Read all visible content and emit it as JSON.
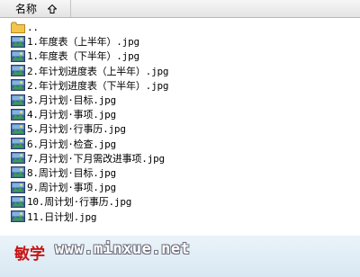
{
  "header": {
    "name_column": "名称",
    "sort_icon": "up-arrow-icon"
  },
  "parent_folder": "..",
  "files": [
    "1.年度表（上半年）.jpg",
    "1.年度表（下半年）.jpg",
    "2.年计划进度表（上半年）.jpg",
    "2.年计划进度表（下半年）.jpg",
    "3.月计划·目标.jpg",
    "4.月计划·事项.jpg",
    "5.月计划·行事历.jpg",
    "6.月计划·检查.jpg",
    "7.月计划·下月需改进事项.jpg",
    "8.周计划·目标.jpg",
    "9.周计划·事项.jpg",
    "10.周计划·行事历.jpg",
    "11.日计划.jpg"
  ],
  "watermark": {
    "logo": "敏学",
    "url": "www.minxue.net"
  },
  "colors": {
    "folder": "#f2c64a",
    "watermark_logo": "#c81414",
    "footer_bg": "#dce9f3"
  }
}
